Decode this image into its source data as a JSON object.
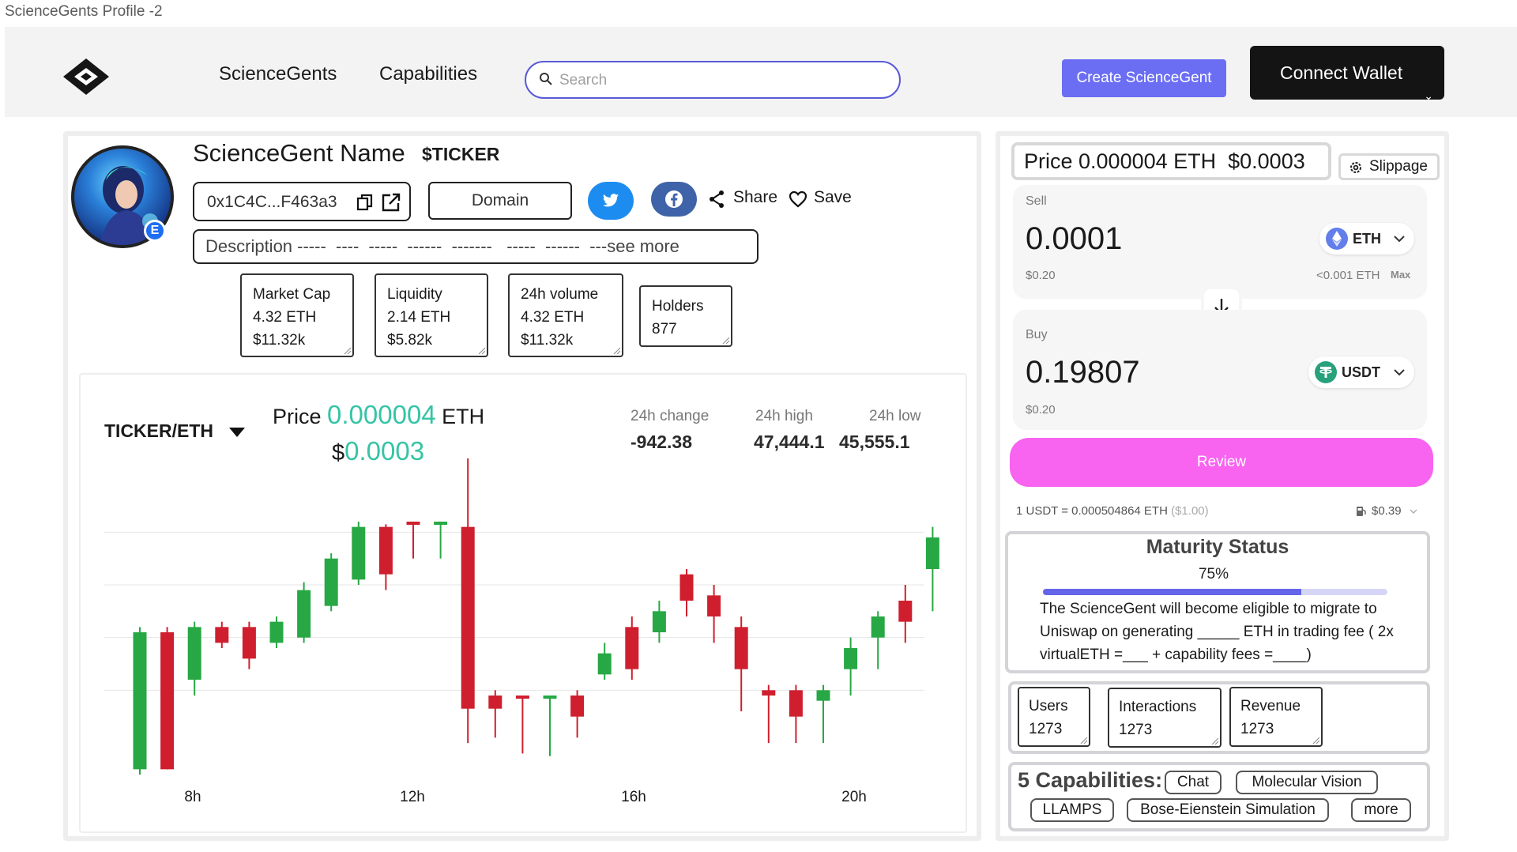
{
  "window_title": "ScienceGents Profile -2",
  "nav": {
    "links": [
      "ScienceGents",
      "Capabilities"
    ],
    "search_placeholder": "Search",
    "create_label": "Create ScienceGent",
    "wallet_label": "Connect Wallet",
    "wallet_caret": "⌄"
  },
  "profile": {
    "name": "ScienceGent Name",
    "ticker": "$TICKER",
    "address": "0x1C4C...F463a3",
    "domain_label": "Domain",
    "share_label": "Share",
    "save_label": "Save",
    "description": "Description -----  ----  -----  ------  -------   -----  ------  ---see more",
    "avatar_badge": "E"
  },
  "stats": [
    {
      "label": "Market Cap",
      "line1": "4.32 ETH",
      "line2": "$11.32k"
    },
    {
      "label": "Liquidity",
      "line1": "2.14 ETH",
      "line2": "$5.82k"
    },
    {
      "label": "24h volume",
      "line1": "4.32 ETH",
      "line2": "$11.32k"
    },
    {
      "label": "Holders",
      "line1": "877",
      "line2": ""
    }
  ],
  "chart_header": {
    "pair": "TICKER/ETH",
    "price_prefix": "Price ",
    "price_value": "0.000004",
    "price_unit": " ETH",
    "usd_prefix": "$",
    "usd_value": "0.0003",
    "change_label": "24h change",
    "change_value": "-942.38",
    "high_label": "24h high",
    "high_value": "47,444.1",
    "low_label": "24h low",
    "low_value": "45,555.1"
  },
  "chart_data": {
    "type": "candlestick",
    "x_ticks": [
      "8h",
      "12h",
      "16h",
      "20h"
    ],
    "y_axis_shown": false,
    "grid": "horizontal",
    "up_color": "#27a844",
    "down_color": "#cf1f2e",
    "candles": [
      {
        "o": 1.0,
        "c": 27.0,
        "h": 28.0,
        "l": 0.0
      },
      {
        "o": 27.0,
        "c": 1.0,
        "h": 28.0,
        "l": 1.0
      },
      {
        "o": 18.0,
        "c": 28.0,
        "h": 29.0,
        "l": 15.0
      },
      {
        "o": 28.0,
        "c": 25.0,
        "h": 29.0,
        "l": 24.0
      },
      {
        "o": 28.0,
        "c": 22.0,
        "h": 29.0,
        "l": 20.0
      },
      {
        "o": 25.0,
        "c": 29.0,
        "h": 30.0,
        "l": 24.0
      },
      {
        "o": 26.0,
        "c": 35.0,
        "h": 36.5,
        "l": 25.0
      },
      {
        "o": 32.0,
        "c": 41.0,
        "h": 42.0,
        "l": 31.0
      },
      {
        "o": 37.0,
        "c": 47.0,
        "h": 48.0,
        "l": 36.0
      },
      {
        "o": 47.0,
        "c": 38.0,
        "h": 47.5,
        "l": 35.0
      },
      {
        "o": 48.0,
        "c": 47.5,
        "h": 48.0,
        "l": 41.0
      },
      {
        "o": 47.5,
        "c": 48.0,
        "h": 48.0,
        "l": 41.0
      },
      {
        "o": 47.0,
        "c": 12.5,
        "h": 60.0,
        "l": 6.0
      },
      {
        "o": 15.0,
        "c": 12.5,
        "h": 16.0,
        "l": 7.0
      },
      {
        "o": 15.0,
        "c": 14.5,
        "h": 15.0,
        "l": 4.0
      },
      {
        "o": 14.5,
        "c": 15.0,
        "h": 15.0,
        "l": 3.5
      },
      {
        "o": 15.0,
        "c": 11.0,
        "h": 16.0,
        "l": 7.0
      },
      {
        "o": 19.0,
        "c": 23.0,
        "h": 25.0,
        "l": 18.0
      },
      {
        "o": 28.0,
        "c": 20.0,
        "h": 30.0,
        "l": 18.0
      },
      {
        "o": 27.0,
        "c": 31.0,
        "h": 33.0,
        "l": 25.0
      },
      {
        "o": 38.0,
        "c": 33.0,
        "h": 39.0,
        "l": 30.0
      },
      {
        "o": 34.0,
        "c": 30.0,
        "h": 36.0,
        "l": 25.0
      },
      {
        "o": 28.0,
        "c": 20.0,
        "h": 30.0,
        "l": 12.0
      },
      {
        "o": 16.0,
        "c": 15.0,
        "h": 17.0,
        "l": 6.0
      },
      {
        "o": 16.0,
        "c": 11.0,
        "h": 17.0,
        "l": 6.0
      },
      {
        "o": 14.0,
        "c": 16.0,
        "h": 17.0,
        "l": 6.0
      },
      {
        "o": 20.0,
        "c": 24.0,
        "h": 26.0,
        "l": 15.0
      },
      {
        "o": 26.0,
        "c": 30.0,
        "h": 31.0,
        "l": 20.0
      },
      {
        "o": 33.0,
        "c": 29.0,
        "h": 36.0,
        "l": 25.0
      },
      {
        "o": 39.0,
        "c": 45.0,
        "h": 47.0,
        "l": 31.0
      }
    ]
  },
  "trade": {
    "price_label": "Price 0.000004 ETH  $0.0003",
    "slippage_label": "Slippage",
    "sell_label": "Sell",
    "sell_amount": "0.0001",
    "sell_usd": "$0.20",
    "sell_token": "ETH",
    "sell_balance": "<0.001 ETH",
    "max_label": "Max",
    "buy_label": "Buy",
    "buy_amount": "0.19807",
    "buy_usd": "$0.20",
    "buy_token": "USDT",
    "review_label": "Review",
    "rate_text": "1 USDT = 0.000504864 ETH ",
    "rate_usd": "($1.00)",
    "fee_text": "$0.39"
  },
  "maturity": {
    "title": "Maturity Status",
    "percent_label": "75%",
    "progress": 0.75,
    "text": "The ScienceGent will become eligible to migrate to Uniswap on generating _____ ETH in trading fee ( 2x virtualETH =___  + capability fees =____)"
  },
  "stats2": [
    {
      "label": "Users",
      "value": "1273"
    },
    {
      "label": "Interactions",
      "value": "1273"
    },
    {
      "label": "Revenue",
      "value": "1273"
    }
  ],
  "capabilities": {
    "title": "5 Capabilities:",
    "chips": [
      "Chat",
      "Molecular Vision",
      "LLAMPS",
      "Bose-Eienstein Simulation",
      "more"
    ]
  },
  "colors": {
    "accent_teal": "#35c4a5",
    "create_button": "#6b6ef3",
    "review_button": "#f863f0",
    "twitter": "#1d8cf0",
    "facebook": "#3f63a8"
  }
}
